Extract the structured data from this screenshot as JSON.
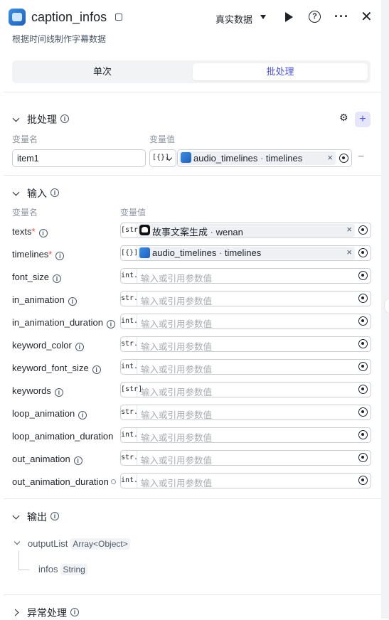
{
  "header": {
    "title": "caption_infos",
    "mode_label": "真实数据",
    "description": "根据时间线制作字幕数据"
  },
  "tabs": [
    {
      "label": "单次",
      "active": false
    },
    {
      "label": "批处理",
      "active": true
    }
  ],
  "batch": {
    "title": "批处理",
    "col_name": "变量名",
    "col_value": "变量值",
    "item_name": "item1",
    "item_type": "[{}]",
    "ref_source": "audio_timelines",
    "ref_field": "timelines"
  },
  "input": {
    "title": "输入",
    "col_name": "变量名",
    "col_value": "变量值",
    "placeholder": "输入或引用参数值",
    "rows": [
      {
        "name": "texts",
        "required": true,
        "type": "[str]",
        "ref_source": "故事文案生成",
        "ref_field": "wenan"
      },
      {
        "name": "timelines",
        "required": true,
        "type": "[{}]",
        "ref_source": "audio_timelines",
        "ref_field": "timelines"
      },
      {
        "name": "font_size",
        "required": false,
        "type": "int."
      },
      {
        "name": "in_animation",
        "required": false,
        "type": "str."
      },
      {
        "name": "in_animation_duration",
        "required": false,
        "type": "int."
      },
      {
        "name": "keyword_color",
        "required": false,
        "type": "str."
      },
      {
        "name": "keyword_font_size",
        "required": false,
        "type": "int."
      },
      {
        "name": "keywords",
        "required": false,
        "type": "[str]"
      },
      {
        "name": "loop_animation",
        "required": false,
        "type": "str."
      },
      {
        "name": "loop_animation_duration",
        "required": false,
        "type": "int."
      },
      {
        "name": "out_animation",
        "required": false,
        "type": "str."
      },
      {
        "name": "out_animation_duration",
        "required": false,
        "type": "int."
      }
    ]
  },
  "output": {
    "title": "输出",
    "items": [
      {
        "name": "outputList",
        "type": "Array<Object>"
      },
      {
        "name": "infos",
        "type": "String"
      }
    ]
  },
  "exception": {
    "title": "异常处理"
  },
  "colors": {
    "accent": "#4d53e8",
    "required": "#f54a45",
    "border": "#c9cdd4"
  }
}
